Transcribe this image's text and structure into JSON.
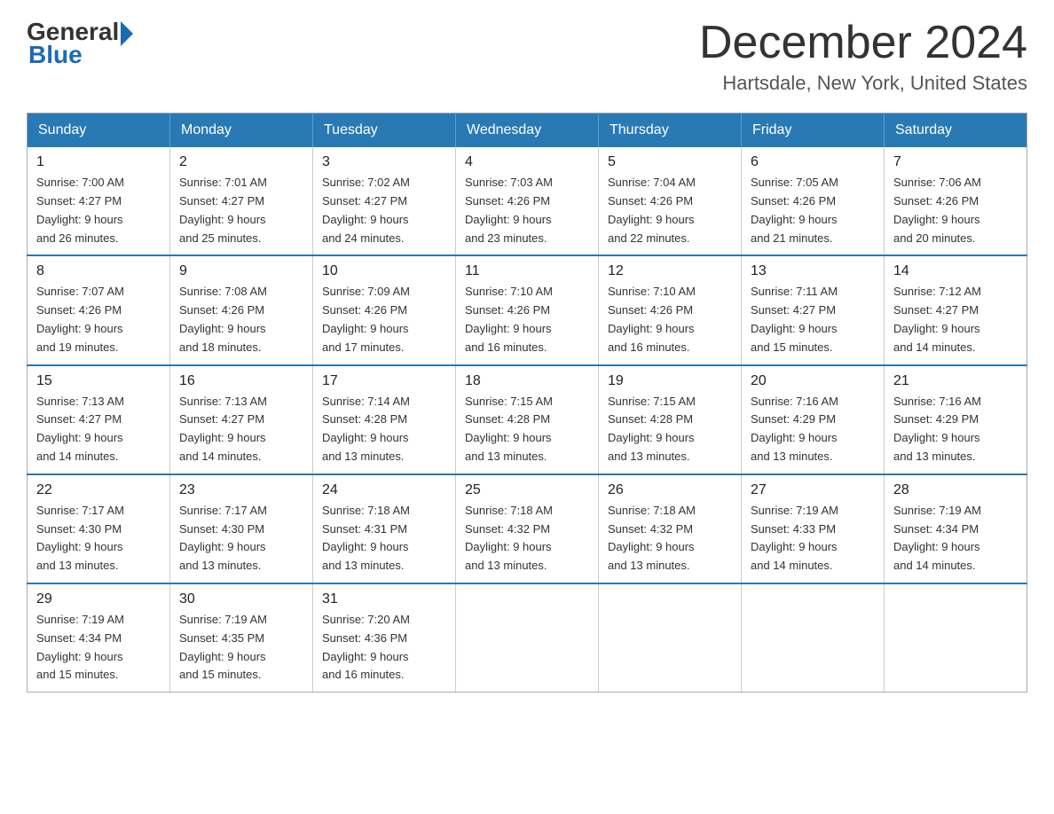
{
  "logo": {
    "general": "General",
    "blue": "Blue"
  },
  "title": "December 2024",
  "location": "Hartsdale, New York, United States",
  "days_of_week": [
    "Sunday",
    "Monday",
    "Tuesday",
    "Wednesday",
    "Thursday",
    "Friday",
    "Saturday"
  ],
  "weeks": [
    [
      {
        "day": "1",
        "sunrise": "7:00 AM",
        "sunset": "4:27 PM",
        "daylight": "9 hours and 26 minutes."
      },
      {
        "day": "2",
        "sunrise": "7:01 AM",
        "sunset": "4:27 PM",
        "daylight": "9 hours and 25 minutes."
      },
      {
        "day": "3",
        "sunrise": "7:02 AM",
        "sunset": "4:27 PM",
        "daylight": "9 hours and 24 minutes."
      },
      {
        "day": "4",
        "sunrise": "7:03 AM",
        "sunset": "4:26 PM",
        "daylight": "9 hours and 23 minutes."
      },
      {
        "day": "5",
        "sunrise": "7:04 AM",
        "sunset": "4:26 PM",
        "daylight": "9 hours and 22 minutes."
      },
      {
        "day": "6",
        "sunrise": "7:05 AM",
        "sunset": "4:26 PM",
        "daylight": "9 hours and 21 minutes."
      },
      {
        "day": "7",
        "sunrise": "7:06 AM",
        "sunset": "4:26 PM",
        "daylight": "9 hours and 20 minutes."
      }
    ],
    [
      {
        "day": "8",
        "sunrise": "7:07 AM",
        "sunset": "4:26 PM",
        "daylight": "9 hours and 19 minutes."
      },
      {
        "day": "9",
        "sunrise": "7:08 AM",
        "sunset": "4:26 PM",
        "daylight": "9 hours and 18 minutes."
      },
      {
        "day": "10",
        "sunrise": "7:09 AM",
        "sunset": "4:26 PM",
        "daylight": "9 hours and 17 minutes."
      },
      {
        "day": "11",
        "sunrise": "7:10 AM",
        "sunset": "4:26 PM",
        "daylight": "9 hours and 16 minutes."
      },
      {
        "day": "12",
        "sunrise": "7:10 AM",
        "sunset": "4:26 PM",
        "daylight": "9 hours and 16 minutes."
      },
      {
        "day": "13",
        "sunrise": "7:11 AM",
        "sunset": "4:27 PM",
        "daylight": "9 hours and 15 minutes."
      },
      {
        "day": "14",
        "sunrise": "7:12 AM",
        "sunset": "4:27 PM",
        "daylight": "9 hours and 14 minutes."
      }
    ],
    [
      {
        "day": "15",
        "sunrise": "7:13 AM",
        "sunset": "4:27 PM",
        "daylight": "9 hours and 14 minutes."
      },
      {
        "day": "16",
        "sunrise": "7:13 AM",
        "sunset": "4:27 PM",
        "daylight": "9 hours and 14 minutes."
      },
      {
        "day": "17",
        "sunrise": "7:14 AM",
        "sunset": "4:28 PM",
        "daylight": "9 hours and 13 minutes."
      },
      {
        "day": "18",
        "sunrise": "7:15 AM",
        "sunset": "4:28 PM",
        "daylight": "9 hours and 13 minutes."
      },
      {
        "day": "19",
        "sunrise": "7:15 AM",
        "sunset": "4:28 PM",
        "daylight": "9 hours and 13 minutes."
      },
      {
        "day": "20",
        "sunrise": "7:16 AM",
        "sunset": "4:29 PM",
        "daylight": "9 hours and 13 minutes."
      },
      {
        "day": "21",
        "sunrise": "7:16 AM",
        "sunset": "4:29 PM",
        "daylight": "9 hours and 13 minutes."
      }
    ],
    [
      {
        "day": "22",
        "sunrise": "7:17 AM",
        "sunset": "4:30 PM",
        "daylight": "9 hours and 13 minutes."
      },
      {
        "day": "23",
        "sunrise": "7:17 AM",
        "sunset": "4:30 PM",
        "daylight": "9 hours and 13 minutes."
      },
      {
        "day": "24",
        "sunrise": "7:18 AM",
        "sunset": "4:31 PM",
        "daylight": "9 hours and 13 minutes."
      },
      {
        "day": "25",
        "sunrise": "7:18 AM",
        "sunset": "4:32 PM",
        "daylight": "9 hours and 13 minutes."
      },
      {
        "day": "26",
        "sunrise": "7:18 AM",
        "sunset": "4:32 PM",
        "daylight": "9 hours and 13 minutes."
      },
      {
        "day": "27",
        "sunrise": "7:19 AM",
        "sunset": "4:33 PM",
        "daylight": "9 hours and 14 minutes."
      },
      {
        "day": "28",
        "sunrise": "7:19 AM",
        "sunset": "4:34 PM",
        "daylight": "9 hours and 14 minutes."
      }
    ],
    [
      {
        "day": "29",
        "sunrise": "7:19 AM",
        "sunset": "4:34 PM",
        "daylight": "9 hours and 15 minutes."
      },
      {
        "day": "30",
        "sunrise": "7:19 AM",
        "sunset": "4:35 PM",
        "daylight": "9 hours and 15 minutes."
      },
      {
        "day": "31",
        "sunrise": "7:20 AM",
        "sunset": "4:36 PM",
        "daylight": "9 hours and 16 minutes."
      },
      null,
      null,
      null,
      null
    ]
  ]
}
